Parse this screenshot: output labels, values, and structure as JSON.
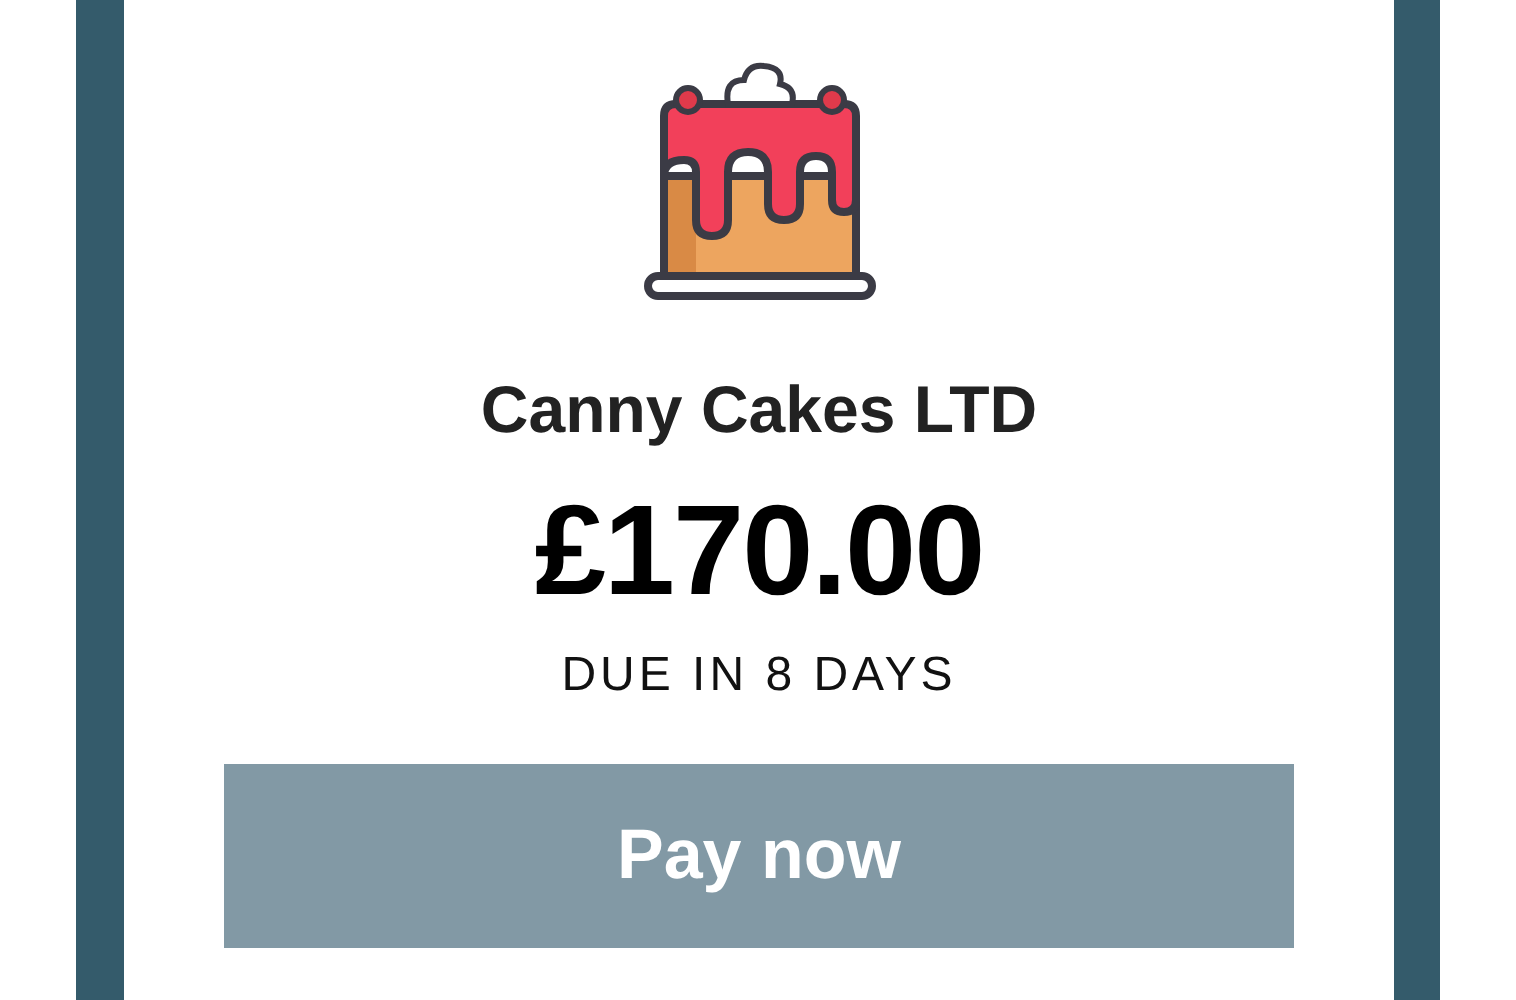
{
  "merchant": "Canny Cakes LTD",
  "amount": "£170.00",
  "due": "DUE IN 8 DAYS",
  "button": "Pay now"
}
